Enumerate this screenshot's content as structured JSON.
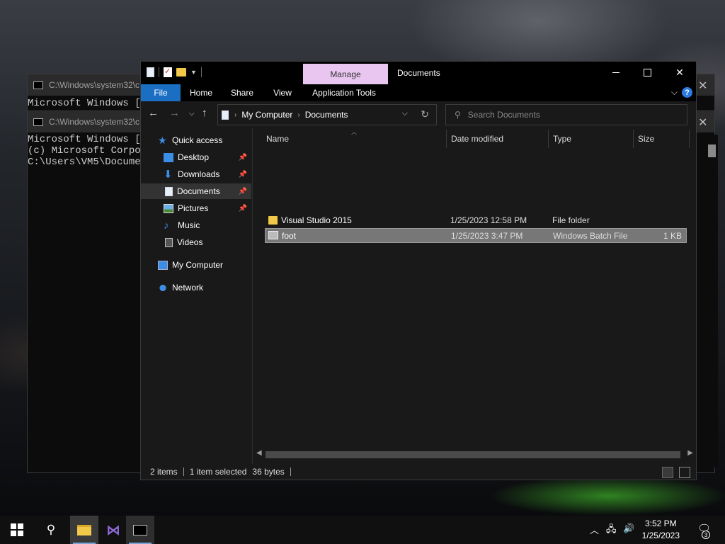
{
  "console_back": {
    "title": "C:\\Windows\\system32\\c",
    "lines": [
      "Microsoft Windows [V",
      "(c) Microsoft Corpor"
    ]
  },
  "console_front": {
    "title": "C:\\Windows\\system32\\c",
    "lines": [
      "Microsoft Windows [V",
      "(c) Microsoft Corpor",
      "",
      "C:\\Users\\VM5\\Documen"
    ]
  },
  "explorer": {
    "title": "Documents",
    "context_tab": "Manage",
    "ribbon_tabs": [
      "File",
      "Home",
      "Share",
      "View",
      "Application Tools"
    ],
    "address": {
      "crumbs": [
        "My Computer",
        "Documents"
      ]
    },
    "search_placeholder": "Search Documents",
    "nav": [
      {
        "label": "Quick access",
        "icon": "star-icon"
      },
      {
        "label": "Desktop",
        "icon": "desktop-icon",
        "pinned": true
      },
      {
        "label": "Downloads",
        "icon": "download-icon",
        "pinned": true
      },
      {
        "label": "Documents",
        "icon": "documents-icon",
        "pinned": true,
        "selected": true
      },
      {
        "label": "Pictures",
        "icon": "pictures-icon",
        "pinned": true
      },
      {
        "label": "Music",
        "icon": "music-icon"
      },
      {
        "label": "Videos",
        "icon": "videos-icon"
      },
      {
        "label": "My Computer",
        "icon": "computer-icon"
      },
      {
        "label": "Network",
        "icon": "network-icon"
      }
    ],
    "columns": [
      "Name",
      "Date modified",
      "Type",
      "Size"
    ],
    "files": [
      {
        "name": "Visual Studio 2015",
        "date": "1/25/2023 12:58 PM",
        "type": "File folder",
        "size": "",
        "icon": "folder-icon"
      },
      {
        "name": "foot",
        "date": "1/25/2023 3:47 PM",
        "type": "Windows Batch File",
        "size": "1 KB",
        "icon": "batch-file-icon",
        "selected": true
      }
    ],
    "status": {
      "count": "2 items",
      "selection": "1 item selected",
      "size": "36 bytes"
    }
  },
  "taskbar": {
    "time": "3:52 PM",
    "date": "1/25/2023",
    "notification_count": "3"
  }
}
